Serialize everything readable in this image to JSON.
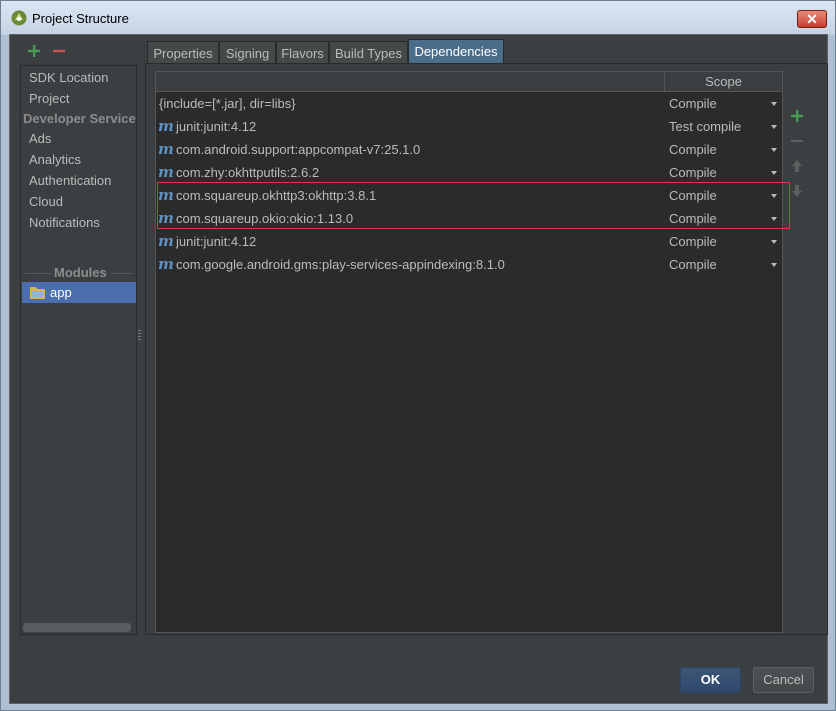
{
  "window": {
    "title": "Project Structure",
    "close_label": "✕"
  },
  "sidebar": {
    "items": [
      {
        "label": "SDK Location"
      },
      {
        "label": "Project"
      }
    ],
    "developer_services_header": "Developer Services",
    "services": [
      {
        "label": "Ads"
      },
      {
        "label": "Analytics"
      },
      {
        "label": "Authentication"
      },
      {
        "label": "Cloud"
      },
      {
        "label": "Notifications"
      }
    ],
    "modules_header": "Modules",
    "modules": [
      {
        "label": "app",
        "selected": true
      }
    ]
  },
  "tabs": [
    {
      "label": "Properties"
    },
    {
      "label": "Signing"
    },
    {
      "label": "Flavors"
    },
    {
      "label": "Build Types"
    },
    {
      "label": "Dependencies",
      "active": true
    }
  ],
  "dependencies": {
    "columns": {
      "name": "",
      "scope": "Scope"
    },
    "rows": [
      {
        "name": "{include=[*.jar], dir=libs}",
        "scope": "Compile",
        "maven": false,
        "highlighted": false
      },
      {
        "name": "junit:junit:4.12",
        "scope": "Test compile",
        "maven": true,
        "highlighted": false
      },
      {
        "name": "com.android.support:appcompat-v7:25.1.0",
        "scope": "Compile",
        "maven": true,
        "highlighted": false
      },
      {
        "name": "com.zhy:okhttputils:2.6.2",
        "scope": "Compile",
        "maven": true,
        "highlighted": false
      },
      {
        "name": "com.squareup.okhttp3:okhttp:3.8.1",
        "scope": "Compile",
        "maven": true,
        "highlighted": true
      },
      {
        "name": "com.squareup.okio:okio:1.13.0",
        "scope": "Compile",
        "maven": true,
        "highlighted": true
      },
      {
        "name": "junit:junit:4.12",
        "scope": "Compile",
        "maven": true,
        "highlighted": false
      },
      {
        "name": "com.google.android.gms:play-services-appindexing:8.1.0",
        "scope": "Compile",
        "maven": true,
        "highlighted": false
      }
    ],
    "maven_glyph": "m"
  },
  "buttons": {
    "ok": "OK",
    "cancel": "Cancel"
  },
  "colors": {
    "accent": "#4b6eaf",
    "add": "#499c54",
    "remove": "#c75450",
    "highlight": "#d9383e"
  }
}
